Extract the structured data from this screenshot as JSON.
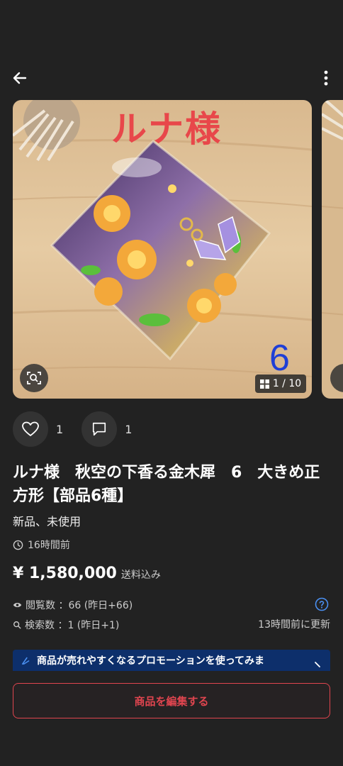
{
  "header": {
    "back_icon": "arrow-left-icon",
    "more_icon": "more-vertical-icon"
  },
  "gallery": {
    "overlay_name": "ルナ様",
    "overlay_number": "6",
    "counter": "1 / 10",
    "image_index": 1,
    "image_total": 10
  },
  "actions": {
    "likes": "1",
    "comments": "1"
  },
  "item": {
    "title": "ルナ様　秋空の下香る金木犀　6　大きめ正方形【部品6種】",
    "condition": "新品、未使用",
    "posted": "16時間前",
    "price": "¥ 1,580,000",
    "shipping": "送料込み"
  },
  "stats": {
    "views": "閲覧数 ：66 (昨日+66)",
    "searches": "検索数 ：1 (昨日+1)",
    "updated": "13時間前に更新"
  },
  "promo": {
    "text": "商品が売れやすくなるプロモーションを使ってみま"
  },
  "edit_button": {
    "label": "商品を編集する"
  },
  "colors": {
    "background": "#222222",
    "accent": "#e0454f",
    "promo_bg": "#0d2f6b",
    "help": "#4a8ff0"
  }
}
